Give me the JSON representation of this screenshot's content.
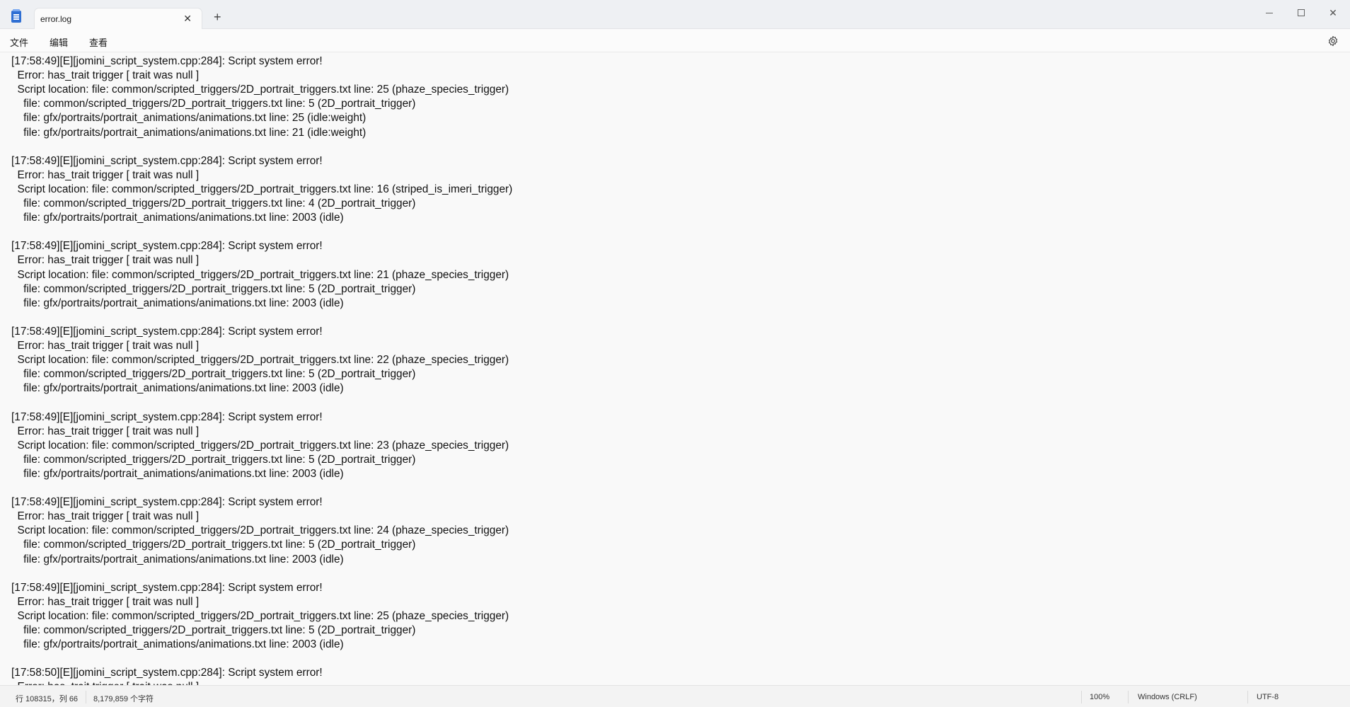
{
  "window": {
    "tab_title": "error.log",
    "tab_close": "✕",
    "tab_add": "+",
    "close_glyph": "✕"
  },
  "menu": {
    "file": "文件",
    "edit": "编辑",
    "view": "查看"
  },
  "editor": {
    "lines": [
      "[17:58:49][E][jomini_script_system.cpp:284]: Script system error!",
      "  Error: has_trait trigger [ trait was null ]",
      "  Script location: file: common/scripted_triggers/2D_portrait_triggers.txt line: 25 (phaze_species_trigger)",
      "    file: common/scripted_triggers/2D_portrait_triggers.txt line: 5 (2D_portrait_trigger)",
      "    file: gfx/portraits/portrait_animations/animations.txt line: 25 (idle:weight)",
      "    file: gfx/portraits/portrait_animations/animations.txt line: 21 (idle:weight)",
      "",
      "[17:58:49][E][jomini_script_system.cpp:284]: Script system error!",
      "  Error: has_trait trigger [ trait was null ]",
      "  Script location: file: common/scripted_triggers/2D_portrait_triggers.txt line: 16 (striped_is_imeri_trigger)",
      "    file: common/scripted_triggers/2D_portrait_triggers.txt line: 4 (2D_portrait_trigger)",
      "    file: gfx/portraits/portrait_animations/animations.txt line: 2003 (idle)",
      "",
      "[17:58:49][E][jomini_script_system.cpp:284]: Script system error!",
      "  Error: has_trait trigger [ trait was null ]",
      "  Script location: file: common/scripted_triggers/2D_portrait_triggers.txt line: 21 (phaze_species_trigger)",
      "    file: common/scripted_triggers/2D_portrait_triggers.txt line: 5 (2D_portrait_trigger)",
      "    file: gfx/portraits/portrait_animations/animations.txt line: 2003 (idle)",
      "",
      "[17:58:49][E][jomini_script_system.cpp:284]: Script system error!",
      "  Error: has_trait trigger [ trait was null ]",
      "  Script location: file: common/scripted_triggers/2D_portrait_triggers.txt line: 22 (phaze_species_trigger)",
      "    file: common/scripted_triggers/2D_portrait_triggers.txt line: 5 (2D_portrait_trigger)",
      "    file: gfx/portraits/portrait_animations/animations.txt line: 2003 (idle)",
      "",
      "[17:58:49][E][jomini_script_system.cpp:284]: Script system error!",
      "  Error: has_trait trigger [ trait was null ]",
      "  Script location: file: common/scripted_triggers/2D_portrait_triggers.txt line: 23 (phaze_species_trigger)",
      "    file: common/scripted_triggers/2D_portrait_triggers.txt line: 5 (2D_portrait_trigger)",
      "    file: gfx/portraits/portrait_animations/animations.txt line: 2003 (idle)",
      "",
      "[17:58:49][E][jomini_script_system.cpp:284]: Script system error!",
      "  Error: has_trait trigger [ trait was null ]",
      "  Script location: file: common/scripted_triggers/2D_portrait_triggers.txt line: 24 (phaze_species_trigger)",
      "    file: common/scripted_triggers/2D_portrait_triggers.txt line: 5 (2D_portrait_trigger)",
      "    file: gfx/portraits/portrait_animations/animations.txt line: 2003 (idle)",
      "",
      "[17:58:49][E][jomini_script_system.cpp:284]: Script system error!",
      "  Error: has_trait trigger [ trait was null ]",
      "  Script location: file: common/scripted_triggers/2D_portrait_triggers.txt line: 25 (phaze_species_trigger)",
      "    file: common/scripted_triggers/2D_portrait_triggers.txt line: 5 (2D_portrait_trigger)",
      "    file: gfx/portraits/portrait_animations/animations.txt line: 2003 (idle)",
      "",
      "[17:58:50][E][jomini_script_system.cpp:284]: Script system error!",
      "  Error: has_trait trigger [ trait was null ]"
    ]
  },
  "status": {
    "position": "行 108315，列 66",
    "char_count": "8,179,859 个字符",
    "zoom": "100%",
    "line_ending": "Windows (CRLF)",
    "encoding": "UTF-8"
  }
}
